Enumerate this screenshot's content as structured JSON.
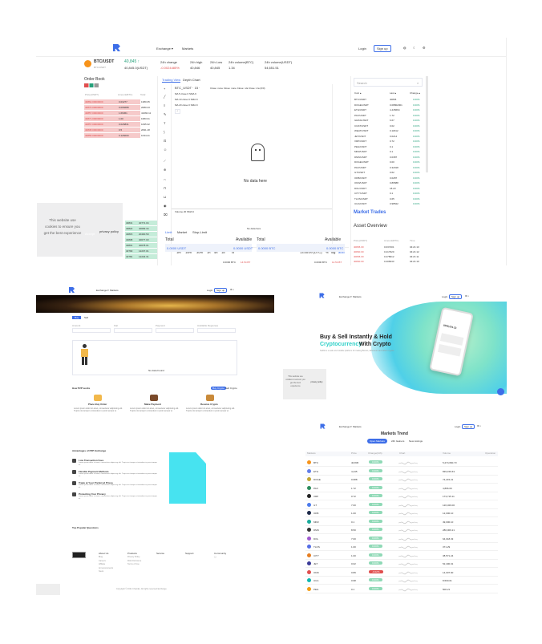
{
  "trade": {
    "nav": {
      "exchange": "Exchange ▾",
      "markets": "Markets",
      "login": "Login",
      "signup": "Sign up"
    },
    "ticker": {
      "pair": "BTC/USDT",
      "pair_sub": "BTC/USDT",
      "price": "40,845 ↑",
      "price_sub": "40,845.0(USDT)",
      "change_label": "24h change",
      "change": "-0.0024485%",
      "high_label": "24h high",
      "high": "40,846",
      "low_label": "24h Low",
      "low": "40,845",
      "vol1_label": "24h volume(BTC)",
      "vol1": "1.34",
      "vol2_label": "24h volume(USDT)",
      "vol2": "54,651.51"
    },
    "orderbook": {
      "title": "Order Book",
      "headers": [
        "Price(USDT)",
        "Amount(BTC)",
        "Total"
      ],
      "asks": [
        [
          "40862.00000000",
          "0.03277",
          "1380.35"
        ],
        [
          "40870.00000000",
          "0.066688",
          "2080.43"
        ],
        [
          "40857.00000000",
          "1.66361",
          "41060.11"
        ],
        [
          "40871.00000000",
          "1.00",
          "1683.31"
        ],
        [
          "40857.00000000",
          "0.026831",
          "1095.32"
        ],
        [
          "40808.00000000",
          "0.5",
          "2091.18"
        ],
        [
          "40855.00000000",
          "0.126000",
          "1034.41"
        ]
      ],
      "bids": [
        [
          "40831",
          "0.01",
          "40771.04"
        ],
        [
          "40822",
          "0.1",
          "40083.34"
        ],
        [
          "40815",
          "0.5",
          "20400.50"
        ],
        [
          "40808",
          "0.2",
          "40077.03"
        ],
        [
          "40801",
          "0.1",
          "40078.01"
        ],
        [
          "40790",
          "0.3",
          "12237.01"
        ],
        [
          "40781",
          "0.3",
          "12234.31"
        ]
      ]
    },
    "chart": {
      "tab_view": "Trading View",
      "tab_depth": "Depth Chart",
      "symbol": "BTC_USDT · 15 ·",
      "ohlc": "Close: none  Close: none  Close: n/a  Close: n/a (0/0)",
      "ma1": "MA 5 close 0 SMA 9",
      "ma2": "MA 10 close 0 SMA 9",
      "ma3": "MA 20 close 0 SMA 9",
      "no_data": "No data here",
      "volume": "Volume 20 SMA 9",
      "no_data2": "No data here",
      "timeframes": [
        "1m",
        "15m",
        "30m",
        "1h",
        "4h",
        "1d"
      ],
      "clock": "13:45:09 (UTC)",
      "pct": "%",
      "log": "log",
      "auto": "auto"
    },
    "form": {
      "tabs": [
        "Limit",
        "Market",
        "Stop-Limit"
      ],
      "price_label": "Total",
      "avail": "Available",
      "amount1": "0.0000 USDT",
      "amount1b": "0.0000 USDT",
      "price_label2": "Total",
      "avail2": "Available",
      "amount2": "0.0000 BTC",
      "amount2b": "0.0000 BTC",
      "foot1": "0.0000 BTC",
      "foot1b": "14.54 BT",
      "foot2": "0.0000 BTC",
      "foot2b": "14.54 BT"
    },
    "markets": {
      "search_placeholder": "Search",
      "headers": [
        "Coin ▴",
        "Last ▴",
        "Change ▴"
      ],
      "rows": [
        [
          "BTC/USDT",
          "40845",
          "0.00%"
        ],
        [
          "DOGE/USDT",
          "0.08802001",
          "0.00%"
        ],
        [
          "ETH/USDT",
          "4.445664",
          "0.00%"
        ],
        [
          "PAX/USDT",
          "1.72",
          "0.00%"
        ],
        [
          "GRAS/USDT",
          "6.67",
          "0.00%"
        ],
        [
          "COAT/USDT",
          "0.02",
          "0.00%"
        ],
        [
          "WEAT/USDT",
          "0.11812",
          "0.00%"
        ],
        [
          "JET/USDT",
          "0.0214",
          "0.00%"
        ],
        [
          "XRP/USDT",
          "0.72",
          "0.00%"
        ],
        [
          "PEG/USDT",
          "0.1",
          "0.00%"
        ],
        [
          "MKR/USDT",
          "0.1",
          "0.00%"
        ],
        [
          "DMN/USDT",
          "0.0387",
          "0.00%"
        ],
        [
          "DOGE/USDT",
          "0.00",
          "0.00%"
        ],
        [
          "PAX/USDT",
          "0.32918",
          "0.00%"
        ],
        [
          "GT/USDT",
          "0.62",
          "0.00%"
        ],
        [
          "OKB/USDT",
          "0.0287",
          "0.00%"
        ],
        [
          "ONN/USDT",
          "0.89588",
          "0.00%"
        ],
        [
          "DOL/USDT",
          "18.23",
          "0.00%"
        ],
        [
          "CITY/USDT",
          "0.1",
          "0.00%"
        ],
        [
          "TLOS/USDT",
          "0.65",
          "0.00%"
        ],
        [
          "UCA/USDT",
          "0.98522",
          "0.00%"
        ]
      ],
      "trades_title": "Market Trades",
      "overview_title": "Asset Overview",
      "trade_headers": [
        "Price(USDT)",
        "Amount(BTC)",
        "Time"
      ],
      "trades": [
        [
          "40845.00",
          "0.037401",
          "04:21:13"
        ],
        [
          "40840.00",
          "0.417920",
          "04:21:12"
        ],
        [
          "40845.00",
          "0.478012",
          "04:21:11"
        ],
        [
          "40840.00",
          "0.406043",
          "04:21:10"
        ]
      ]
    },
    "cookie": {
      "text": "This website use cookies to ensure you get the best experience",
      "btn1": "Accept",
      "btn2": "privacy policy"
    }
  },
  "landing": {
    "nav": {
      "exchange": "Exchange ▾",
      "markets": "Markets",
      "login": "Login",
      "signup": "Sign up"
    },
    "filter_buttons": [
      "Buy",
      "Sell"
    ],
    "filter_labels": [
      "Amount",
      "Fiat",
      "Payment",
      "Available Region(s)"
    ],
    "no_result": "No data Found",
    "how_title": "How P2P works",
    "how_tabs": [
      "Buy Crypto",
      "Sell Crypto"
    ],
    "steps": [
      {
        "title": "Place Buy Order",
        "text": "Lorem ipsum dolor sit amet, consectetur adipiscing elit. Turpis nisi tempor ut interdum in proin tempor et"
      },
      {
        "title": "Make Payment",
        "text": "Lorem ipsum dolor sit amet, consectetur adipiscing elit. Turpis nisi tempor ut interdum in proin tempor et"
      },
      {
        "title": "Receive Crypto",
        "text": "Lorem ipsum dolor sit amet, consectetur adipiscing elit. Turpis nisi tempor ut interdum in proin tempor et"
      }
    ],
    "adv_title": "Advantages of P2P Exchange",
    "advantages": [
      {
        "title": "Low Transaction Fees",
        "text": "Lorem ipsum dolor sit amet, consectetur adipiscing elit. Turpis nisi tempor ut interdum in proin tempor et."
      },
      {
        "title": "Flexible Payment Methods",
        "text": "Lorem ipsum dolor sit amet, consectetur adipiscing elit. Turpis nisi tempor ut interdum in proin tempor et."
      },
      {
        "title": "Trade at Your Preferred Prices",
        "text": "Lorem ipsum dolor sit amet, consectetur adipiscing elit. Turpis nisi tempor ut interdum in proin tempor et."
      },
      {
        "title": "Protecting Your Privacy",
        "text": "Lorem ipsum dolor sit amet, consectetur adipiscing elit. Turpis nisi tempor ut interdum in proin tempor et."
      }
    ],
    "faq_title": "Top Popular Questions",
    "footer_cols": [
      {
        "title": "About Us",
        "items": [
          "Blog",
          "Careers",
          "Affiliate",
          "Announcements",
          "News"
        ]
      },
      {
        "title": "Products",
        "items": [
          "Privacy Policy",
          "Risk Disclosure",
          "Terms of Use"
        ]
      },
      {
        "title": "Service",
        "items": []
      },
      {
        "title": "Support",
        "items": []
      },
      {
        "title": "Community",
        "items": [
          "◯"
        ]
      }
    ],
    "copyright": "Copyright © 2021 ChainEx, All rights reserved Exchange"
  },
  "hero": {
    "nav": {
      "exchange": "Exchange ▾",
      "markets": "Markets",
      "login": "Login",
      "signup": "Sign up"
    },
    "headline1": "Buy & Sell Instantly & Hold",
    "headline2a": "Cryptocurrency",
    "headline2b": " With Crypto",
    "sub": "Sellbit is a safe and reliable platform for trading Bitcoin, Ethereum and other cryptos",
    "phone_amount": "$308,201.23",
    "cookie": {
      "text": "This website use cookies to ensure you get the best experience",
      "btn": "privacy policy"
    }
  },
  "marketlist": {
    "nav": {
      "exchange": "Exchange ▾",
      "markets": "Markets",
      "login": "Login",
      "signup": "Sign up"
    },
    "title": "Markets Trend",
    "tabs": [
      "Open Markets",
      "24h Gainers",
      "New Listings"
    ],
    "headers": [
      "Markets",
      "Price",
      "Change(24h)",
      "Chart",
      "Volume",
      "Operation"
    ],
    "rows": [
      {
        "name": "BTC",
        "price": "40,845",
        "change": "0.00%",
        "vol": "5,274,660.73"
      },
      {
        "name": "ETH",
        "price": "4,445",
        "change": "0.00%",
        "vol": "839,156.63"
      },
      {
        "name": "DOGE",
        "price": "0.088",
        "change": "0.00%",
        "vol": "74,215.21"
      },
      {
        "name": "PAX",
        "price": "1.72",
        "change": "0.00%",
        "vol": "4,896.00"
      },
      {
        "name": "XRP",
        "price": "0.72",
        "change": "0.00%",
        "vol": "173,715.11"
      },
      {
        "name": "GT",
        "price": "7.00",
        "change": "0.00%",
        "vol": "120,329.00"
      },
      {
        "name": "OKB",
        "price": "1.00",
        "change": "0.00%",
        "vol": "12,000.10"
      },
      {
        "name": "MKR",
        "price": "0.1",
        "change": "0.00%",
        "vol": "49,000.10"
      },
      {
        "name": "DMN",
        "price": "8.50",
        "change": "0.00%",
        "vol": "280,006.21"
      },
      {
        "name": "DOL",
        "price": "7.00",
        "change": "0.00%",
        "vol": "64,018.33"
      },
      {
        "name": "TLOS",
        "price": "1.00",
        "change": "0.00%",
        "vol": "371.29"
      },
      {
        "name": "CITY",
        "price": "1.00",
        "change": "0.00%",
        "vol": "38,571.24"
      },
      {
        "name": "JET",
        "price": "0.02",
        "change": "0.00%",
        "vol": "52,400.01"
      },
      {
        "name": "ONN",
        "price": "0.89",
        "change": "-0.02%",
        "vol": "14,007.90"
      },
      {
        "name": "UCA",
        "price": "0.98",
        "change": "0.00%",
        "vol": "8,500.01"
      },
      {
        "name": "PEG",
        "price": "0.1",
        "change": "0.00%",
        "vol": "500.21"
      }
    ]
  },
  "colors": {
    "brand": "#3d6ee8",
    "green": "#26a17b",
    "red": "#e04e4e",
    "ask_bg": "#f6caca",
    "bid_bg": "#c5ecd9",
    "cyan": "#47e3f0",
    "teal": "#2fd0c8"
  }
}
